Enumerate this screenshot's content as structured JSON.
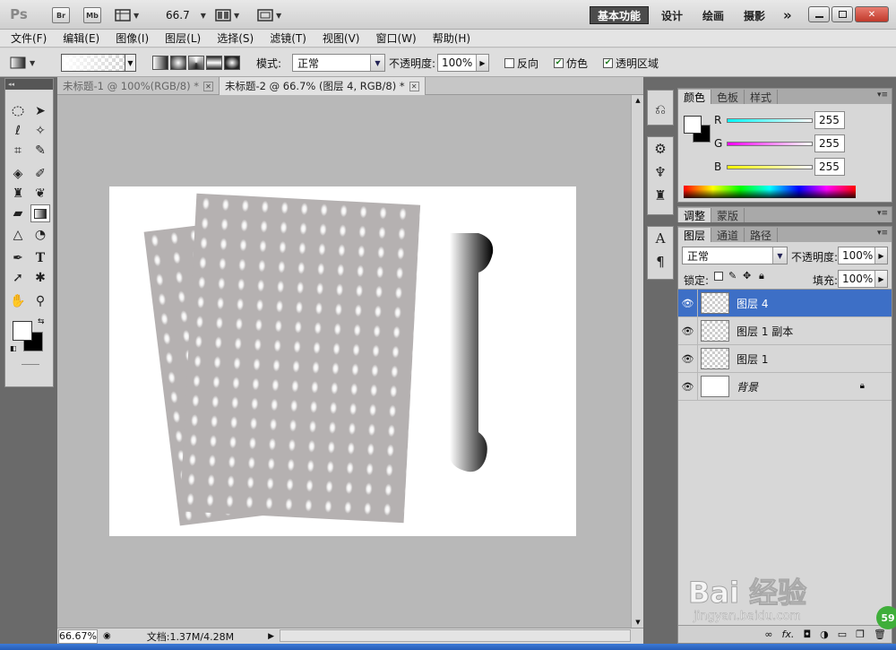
{
  "app": {
    "logo": "Ps",
    "bridge_label": "Br",
    "minibridge_label": "Mb",
    "zoom_value": "66.7",
    "workspaces": [
      "基本功能",
      "设计",
      "绘画",
      "摄影"
    ],
    "more_label": "»"
  },
  "menu": [
    "文件(F)",
    "编辑(E)",
    "图像(I)",
    "图层(L)",
    "选择(S)",
    "滤镜(T)",
    "视图(V)",
    "窗口(W)",
    "帮助(H)"
  ],
  "options": {
    "mode_label": "模式:",
    "mode_value": "正常",
    "opacity_label": "不透明度:",
    "opacity_value": "100%",
    "reverse_label": "反向",
    "reverse_checked": false,
    "dither_label": "仿色",
    "dither_checked": true,
    "transparency_label": "透明区域",
    "transparency_checked": true
  },
  "documents": [
    {
      "title": "未标题-1 @ 100%(RGB/8) *",
      "active": false
    },
    {
      "title": "未标题-2 @ 66.7% (图层 4, RGB/8) *",
      "active": true
    }
  ],
  "status": {
    "zoom": "66.67%",
    "doc_info": "文档:1.37M/4.28M"
  },
  "color_panel": {
    "tabs": [
      "颜色",
      "色板",
      "样式"
    ],
    "r_label": "R",
    "r_value": "255",
    "g_label": "G",
    "g_value": "255",
    "b_label": "B",
    "b_value": "255"
  },
  "adjust_panel": {
    "tabs": [
      "调整",
      "蒙版"
    ]
  },
  "layers_panel": {
    "tabs": [
      "图层",
      "通道",
      "路径"
    ],
    "blend_mode": "正常",
    "opacity_label": "不透明度:",
    "opacity_value": "100%",
    "lock_label": "锁定:",
    "fill_label": "填充:",
    "fill_value": "100%",
    "layers": [
      {
        "name": "图层 4",
        "selected": true
      },
      {
        "name": "图层 1 副本",
        "selected": false
      },
      {
        "name": "图层 1",
        "selected": false
      },
      {
        "name": "背景",
        "selected": false,
        "locked": true
      }
    ]
  },
  "colors": {
    "selected_layer": "#3d6fc6",
    "close_button": "#c0392b"
  },
  "watermark": {
    "brand": "Bai 经验",
    "url": "jingyan.baidu.com",
    "badge": "59"
  }
}
